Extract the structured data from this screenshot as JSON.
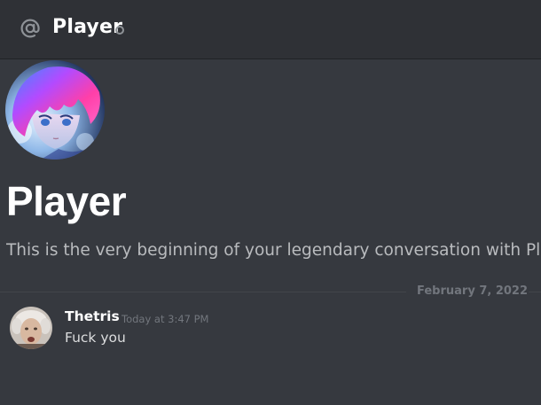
{
  "header": {
    "icon": "at-icon",
    "title": "Player",
    "status": "offline"
  },
  "welcome": {
    "avatar": "anime-avatar",
    "name": "Player",
    "description": "This is the very beginning of your legendary conversation with Playe"
  },
  "divider": {
    "date": "February 7, 2022"
  },
  "messages": [
    {
      "avatar": "face-avatar",
      "author": "Thetris",
      "timestamp": "Today at 3:47 PM",
      "text": "Fuck you"
    }
  ],
  "colors": {
    "background": "#36393f",
    "header": "#2f3136",
    "text_primary": "#ffffff",
    "text_muted": "#72767d",
    "status_offline": "#8e9297"
  }
}
